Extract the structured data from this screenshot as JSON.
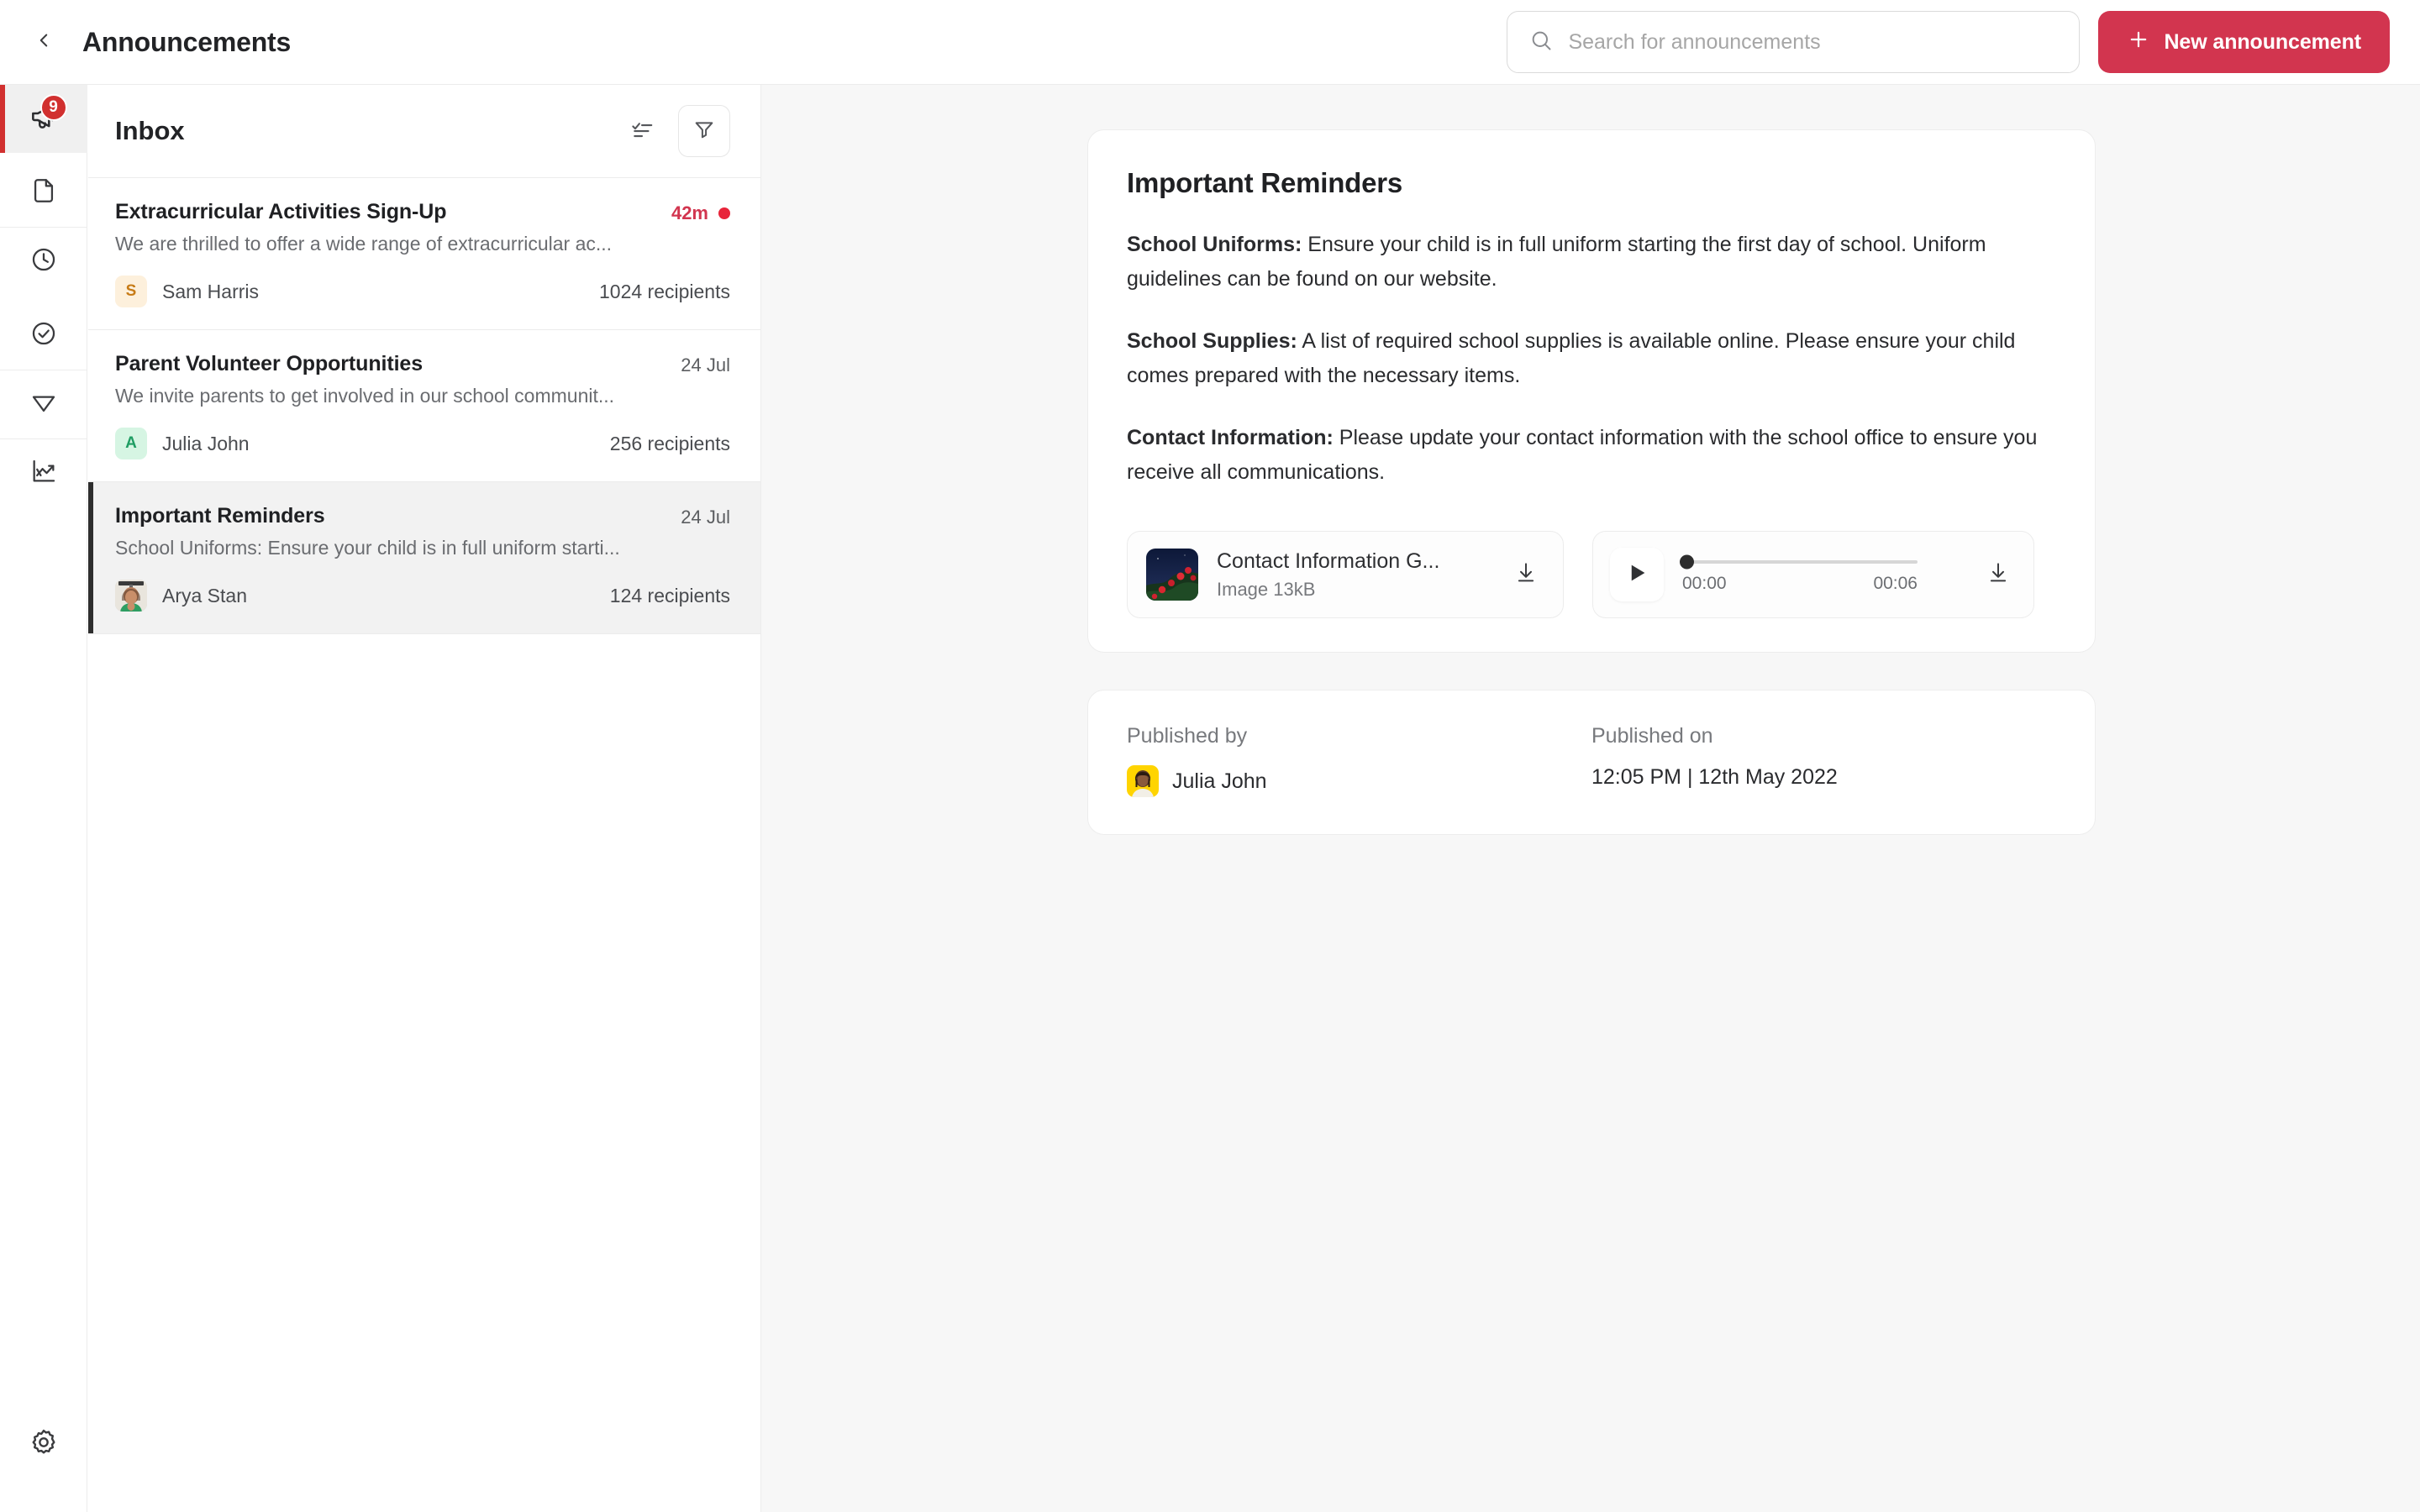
{
  "header": {
    "back_icon": "chevron-left-icon",
    "title": "Announcements",
    "search": {
      "icon": "search-icon",
      "placeholder": "Search for announcements",
      "value": ""
    },
    "new_button": {
      "icon": "plus-icon",
      "label": "New announcement"
    }
  },
  "colors": {
    "accent_red": "#d2354f",
    "badge_red": "#d1302f",
    "unread_dot": "#e8243a",
    "selected_bar": "#2e2e2e",
    "panel_bg": "#f7f7f7"
  },
  "rail": {
    "items": [
      {
        "name": "announcements",
        "icon": "megaphone-icon",
        "badge": "9",
        "active": true
      },
      {
        "name": "documents",
        "icon": "document-icon",
        "badge": "",
        "active": false
      },
      {
        "name": "scheduled",
        "icon": "clock-icon",
        "badge": "",
        "active": false
      },
      {
        "name": "approvals",
        "icon": "check-circle-icon",
        "badge": "",
        "active": false
      },
      {
        "name": "sent",
        "icon": "send-icon",
        "badge": "",
        "active": false
      },
      {
        "name": "analytics",
        "icon": "analytics-icon",
        "badge": "",
        "active": false
      }
    ],
    "settings": {
      "name": "settings",
      "icon": "gear-icon"
    }
  },
  "inbox": {
    "title": "Inbox",
    "sort_icon": "sort-icon",
    "filter_icon": "filter-icon",
    "items": [
      {
        "title": "Extracurricular Activities Sign-Up",
        "preview": "We are thrilled to offer a wide range of extracurricular ac...",
        "time": "42m",
        "unread": true,
        "author": "Sam Harris",
        "avatar_initial": "S",
        "avatar_bg": "#fdf0dc",
        "avatar_fg": "#c77b16",
        "avatar_type": "initial",
        "recipients": "1024 recipients",
        "selected": false
      },
      {
        "title": "Parent Volunteer Opportunities",
        "preview": "We invite parents to get involved in our school communit...",
        "time": "24 Jul",
        "unread": false,
        "author": "Julia John",
        "avatar_initial": "A",
        "avatar_bg": "#d6f5e3",
        "avatar_fg": "#1f9d63",
        "avatar_type": "initial",
        "recipients": "256 recipients",
        "selected": false
      },
      {
        "title": "Important Reminders",
        "preview": "School Uniforms: Ensure your child is in full uniform starti...",
        "time": "24 Jul",
        "unread": false,
        "author": "Arya Stan",
        "avatar_initial": "",
        "avatar_bg": "#e8e3d8",
        "avatar_fg": "#333333",
        "avatar_type": "photo",
        "recipients": "124 recipients",
        "selected": true
      }
    ]
  },
  "announcement": {
    "title": "Important Reminders",
    "paragraphs": [
      {
        "bold": "School Uniforms:",
        "text": " Ensure your child is in full uniform starting the first day of school. Uniform guidelines can be found on our website."
      },
      {
        "bold": "School Supplies:",
        "text": " A list of required school supplies is available online. Please ensure your child comes prepared with the necessary items."
      },
      {
        "bold": "Contact Information:",
        "text": " Please update your contact information with the school office to ensure you receive all communications."
      }
    ],
    "attachment": {
      "name": "Contact Information G...",
      "meta": "Image 13kB",
      "download_icon": "download-icon",
      "thumbnail": "roses-night-sky-photo"
    },
    "audio": {
      "play_icon": "play-icon",
      "current_time": "00:00",
      "duration": "00:06",
      "progress_percent": 0,
      "download_icon": "download-icon"
    },
    "published_by_label": "Published by",
    "published_by_name": "Julia John",
    "published_on_label": "Published on",
    "published_on_value": "12:05 PM | 12th May 2022"
  }
}
